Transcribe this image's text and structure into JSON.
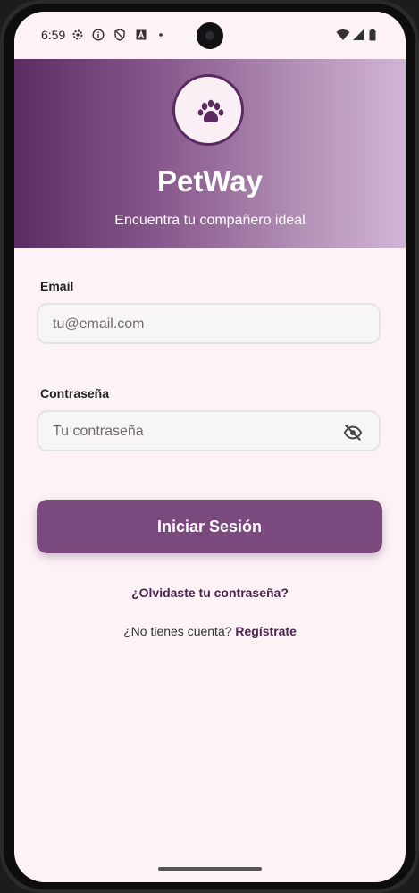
{
  "status_bar": {
    "time": "6:59",
    "icons": [
      "settings-icon",
      "info-icon",
      "shield-icon",
      "a-icon",
      "dot-icon",
      "wifi-icon",
      "signal-icon",
      "battery-icon"
    ]
  },
  "header": {
    "logo_icon": "paw-icon",
    "title": "PetWay",
    "subtitle": "Encuentra tu compañero ideal",
    "gradient": [
      "#5c2a63",
      "#d2b5d4"
    ]
  },
  "form": {
    "email_label": "Email",
    "email_placeholder": "tu@email.com",
    "password_label": "Contraseña",
    "password_placeholder": "Tu contraseña",
    "password_toggle_icon": "eye-off-icon",
    "login_button": "Iniciar Sesión",
    "forgot_link": "¿Olvidaste tu contraseña?",
    "no_account_text": "¿No tienes cuenta?",
    "register_link": "Regístrate"
  },
  "colors": {
    "accent": "#7a4a7e",
    "background": "#fdf3f6",
    "link": "#4a2550"
  }
}
